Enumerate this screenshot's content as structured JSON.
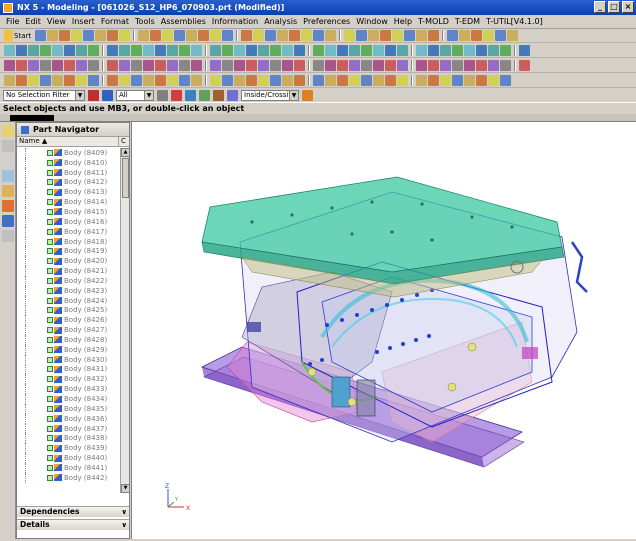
{
  "window": {
    "title": "NX 5 - Modeling - [061026_S12_HP6_070903.prt (Modified)]"
  },
  "menu": [
    "File",
    "Edit",
    "View",
    "Insert",
    "Format",
    "Tools",
    "Assemblies",
    "Information",
    "Analysis",
    "Preferences",
    "Window",
    "Help",
    "T-MOLD",
    "T-EDM",
    "T-UTIL[V4.1.0]"
  ],
  "toolbar": {
    "start_label": "Start"
  },
  "selection": {
    "filter": "No Selection Filter",
    "scope": "All",
    "mode": "Inside/Crossing"
  },
  "status_message": "Select objects and use MB3, or double-click an object",
  "navigator": {
    "title": "Part Navigator",
    "col_name": "Name",
    "col_c": "C",
    "items": [
      "Body (8409)",
      "Body (8410)",
      "Body (8411)",
      "Body (8412)",
      "Body (8413)",
      "Body (8414)",
      "Body (8415)",
      "Body (8416)",
      "Body (8417)",
      "Body (8418)",
      "Body (8419)",
      "Body (8420)",
      "Body (8421)",
      "Body (8422)",
      "Body (8423)",
      "Body (8424)",
      "Body (8425)",
      "Body (8426)",
      "Body (8427)",
      "Body (8428)",
      "Body (8429)",
      "Body (8430)",
      "Body (8431)",
      "Body (8432)",
      "Body (8433)",
      "Body (8434)",
      "Body (8435)",
      "Body (8436)",
      "Body (8437)",
      "Body (8438)",
      "Body (8439)",
      "Body (8440)",
      "Body (8441)",
      "Body (8442)"
    ],
    "panels": [
      "Dependencies",
      "Details"
    ]
  },
  "triad": {
    "x": "X",
    "y": "Y",
    "z": "Z"
  },
  "colors": {
    "title_bar": "#0a3fb0",
    "plate_top": "#3cc8a0",
    "body_blue": "#4040d0",
    "base_purple": "#9a6ad8",
    "pink": "#e070c0"
  }
}
